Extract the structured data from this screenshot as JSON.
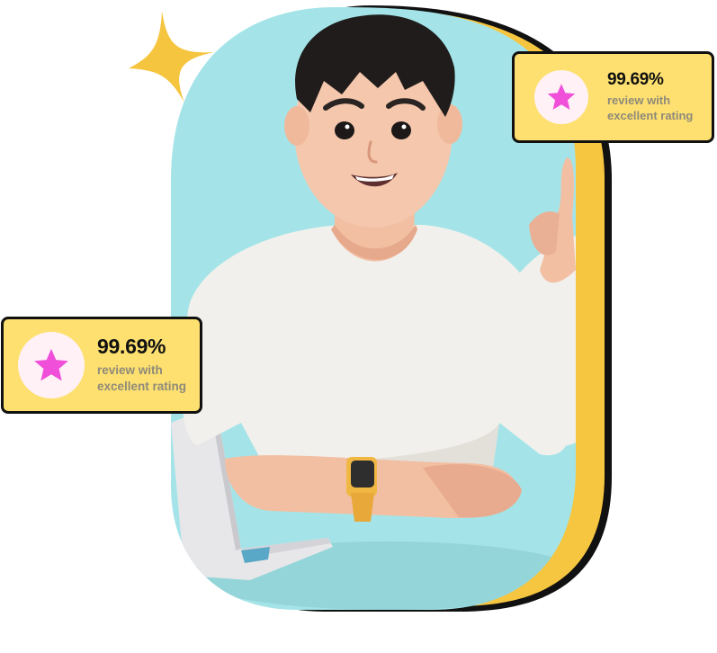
{
  "colors": {
    "background": "#ffffff",
    "frame_teal": "#a4e4e8",
    "frame_shadow_yellow": "#f7c640",
    "frame_shadow_outline": "#111111",
    "sparkle": "#f6c53f",
    "card_fill": "#fde06f",
    "card_border": "#111111",
    "star": "#f04fd9",
    "star_badge": "#fff1f6",
    "caption": "#8f8a7a"
  },
  "illustration": {
    "subject": "3D cartoon young man in white t-shirt pointing up, sitting at desk with laptop, wearing yellow smartwatch"
  },
  "rating_cards": [
    {
      "id": "left",
      "icon": "star-icon",
      "value": "99.69%",
      "caption_line1": "review with",
      "caption_line2": "excellent rating"
    },
    {
      "id": "right",
      "icon": "star-icon",
      "value": "99.69%",
      "caption_line1": "review with",
      "caption_line2": "excellent rating"
    }
  ]
}
